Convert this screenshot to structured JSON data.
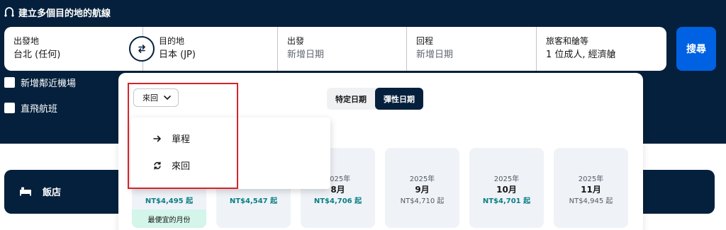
{
  "header": {
    "multi_city_label": "建立多個目的地的航線"
  },
  "search": {
    "from": {
      "label": "出發地",
      "value": "台北 (任何)"
    },
    "to": {
      "label": "目的地",
      "value": "日本 (JP)"
    },
    "depart": {
      "label": "出發",
      "value": "新增日期"
    },
    "return": {
      "label": "回程",
      "value": "新增日期"
    },
    "travellers": {
      "label": "旅客和艙等",
      "value": "1 位成人, 經濟艙"
    },
    "search_button": "搜尋"
  },
  "options": {
    "nearby_airports": "新增鄰近機場",
    "direct_flights": "直飛航班"
  },
  "date_panel": {
    "trip_type_selected": "來回",
    "tabs": [
      {
        "label": "特定日期",
        "active": false
      },
      {
        "label": "彈性日期",
        "active": true
      }
    ],
    "trip_type_options": [
      {
        "label": "單程",
        "icon": "arrow-right-icon"
      },
      {
        "label": "來回",
        "icon": "round-trip-icon"
      }
    ],
    "months": [
      {
        "year": "",
        "month": "",
        "price": "NT$4,495 起",
        "deal": true
      },
      {
        "year": "",
        "month": "",
        "price": "NT$4,547 起",
        "deal": true
      },
      {
        "year": "2025年",
        "month": "8月",
        "price": "NT$4,706 起",
        "deal": true
      },
      {
        "year": "2025年",
        "month": "9月",
        "price": "NT$4,710 起",
        "deal": false
      },
      {
        "year": "2025年",
        "month": "10月",
        "price": "NT$4,701 起",
        "deal": true
      },
      {
        "year": "2025年",
        "month": "11月",
        "price": "NT$4,945 起",
        "deal": false
      }
    ],
    "cheapest_label": "最便宜的月份"
  },
  "hotels": {
    "label": "飯店"
  },
  "colors": {
    "navy": "#05203c",
    "primary": "#0062e3",
    "deal_teal": "#0b7e83",
    "cheapest_bg": "#d3f5ea",
    "highlight_red": "#d6232c"
  }
}
